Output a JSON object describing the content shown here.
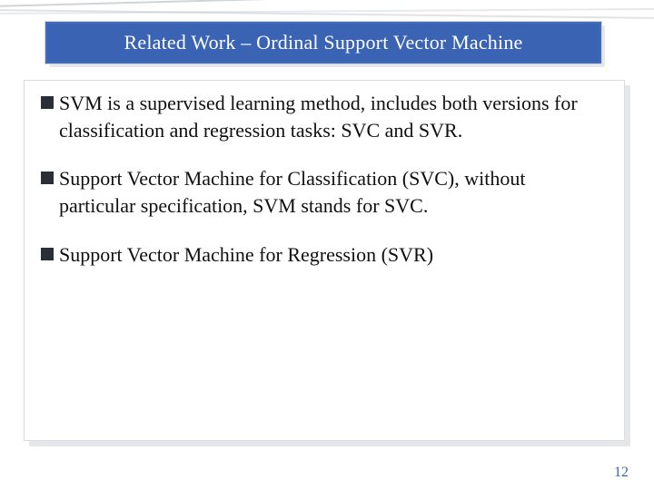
{
  "title": "Related Work – Ordinal Support Vector Machine",
  "bullets": [
    "SVM is a supervised learning method, includes both versions for classification and regression tasks: SVC and SVR.",
    "Support Vector Machine for Classification (SVC), without particular specification, SVM stands for SVC.",
    "Support Vector Machine for Regression (SVR)"
  ],
  "page_number": "12"
}
